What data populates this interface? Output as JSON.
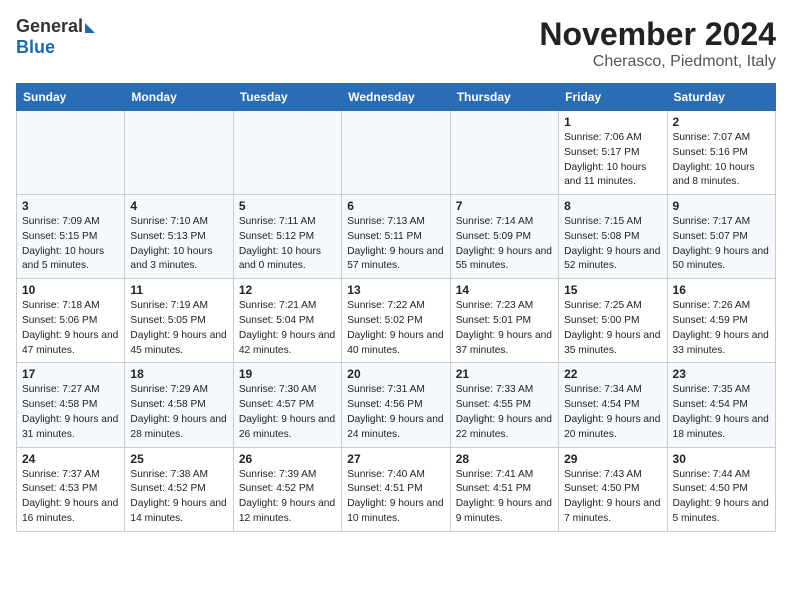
{
  "logo": {
    "general": "General",
    "blue": "Blue"
  },
  "title": "November 2024",
  "subtitle": "Cherasco, Piedmont, Italy",
  "header_days": [
    "Sunday",
    "Monday",
    "Tuesday",
    "Wednesday",
    "Thursday",
    "Friday",
    "Saturday"
  ],
  "weeks": [
    [
      {
        "day": "",
        "info": ""
      },
      {
        "day": "",
        "info": ""
      },
      {
        "day": "",
        "info": ""
      },
      {
        "day": "",
        "info": ""
      },
      {
        "day": "",
        "info": ""
      },
      {
        "day": "1",
        "info": "Sunrise: 7:06 AM\nSunset: 5:17 PM\nDaylight: 10 hours and 11 minutes."
      },
      {
        "day": "2",
        "info": "Sunrise: 7:07 AM\nSunset: 5:16 PM\nDaylight: 10 hours and 8 minutes."
      }
    ],
    [
      {
        "day": "3",
        "info": "Sunrise: 7:09 AM\nSunset: 5:15 PM\nDaylight: 10 hours and 5 minutes."
      },
      {
        "day": "4",
        "info": "Sunrise: 7:10 AM\nSunset: 5:13 PM\nDaylight: 10 hours and 3 minutes."
      },
      {
        "day": "5",
        "info": "Sunrise: 7:11 AM\nSunset: 5:12 PM\nDaylight: 10 hours and 0 minutes."
      },
      {
        "day": "6",
        "info": "Sunrise: 7:13 AM\nSunset: 5:11 PM\nDaylight: 9 hours and 57 minutes."
      },
      {
        "day": "7",
        "info": "Sunrise: 7:14 AM\nSunset: 5:09 PM\nDaylight: 9 hours and 55 minutes."
      },
      {
        "day": "8",
        "info": "Sunrise: 7:15 AM\nSunset: 5:08 PM\nDaylight: 9 hours and 52 minutes."
      },
      {
        "day": "9",
        "info": "Sunrise: 7:17 AM\nSunset: 5:07 PM\nDaylight: 9 hours and 50 minutes."
      }
    ],
    [
      {
        "day": "10",
        "info": "Sunrise: 7:18 AM\nSunset: 5:06 PM\nDaylight: 9 hours and 47 minutes."
      },
      {
        "day": "11",
        "info": "Sunrise: 7:19 AM\nSunset: 5:05 PM\nDaylight: 9 hours and 45 minutes."
      },
      {
        "day": "12",
        "info": "Sunrise: 7:21 AM\nSunset: 5:04 PM\nDaylight: 9 hours and 42 minutes."
      },
      {
        "day": "13",
        "info": "Sunrise: 7:22 AM\nSunset: 5:02 PM\nDaylight: 9 hours and 40 minutes."
      },
      {
        "day": "14",
        "info": "Sunrise: 7:23 AM\nSunset: 5:01 PM\nDaylight: 9 hours and 37 minutes."
      },
      {
        "day": "15",
        "info": "Sunrise: 7:25 AM\nSunset: 5:00 PM\nDaylight: 9 hours and 35 minutes."
      },
      {
        "day": "16",
        "info": "Sunrise: 7:26 AM\nSunset: 4:59 PM\nDaylight: 9 hours and 33 minutes."
      }
    ],
    [
      {
        "day": "17",
        "info": "Sunrise: 7:27 AM\nSunset: 4:58 PM\nDaylight: 9 hours and 31 minutes."
      },
      {
        "day": "18",
        "info": "Sunrise: 7:29 AM\nSunset: 4:58 PM\nDaylight: 9 hours and 28 minutes."
      },
      {
        "day": "19",
        "info": "Sunrise: 7:30 AM\nSunset: 4:57 PM\nDaylight: 9 hours and 26 minutes."
      },
      {
        "day": "20",
        "info": "Sunrise: 7:31 AM\nSunset: 4:56 PM\nDaylight: 9 hours and 24 minutes."
      },
      {
        "day": "21",
        "info": "Sunrise: 7:33 AM\nSunset: 4:55 PM\nDaylight: 9 hours and 22 minutes."
      },
      {
        "day": "22",
        "info": "Sunrise: 7:34 AM\nSunset: 4:54 PM\nDaylight: 9 hours and 20 minutes."
      },
      {
        "day": "23",
        "info": "Sunrise: 7:35 AM\nSunset: 4:54 PM\nDaylight: 9 hours and 18 minutes."
      }
    ],
    [
      {
        "day": "24",
        "info": "Sunrise: 7:37 AM\nSunset: 4:53 PM\nDaylight: 9 hours and 16 minutes."
      },
      {
        "day": "25",
        "info": "Sunrise: 7:38 AM\nSunset: 4:52 PM\nDaylight: 9 hours and 14 minutes."
      },
      {
        "day": "26",
        "info": "Sunrise: 7:39 AM\nSunset: 4:52 PM\nDaylight: 9 hours and 12 minutes."
      },
      {
        "day": "27",
        "info": "Sunrise: 7:40 AM\nSunset: 4:51 PM\nDaylight: 9 hours and 10 minutes."
      },
      {
        "day": "28",
        "info": "Sunrise: 7:41 AM\nSunset: 4:51 PM\nDaylight: 9 hours and 9 minutes."
      },
      {
        "day": "29",
        "info": "Sunrise: 7:43 AM\nSunset: 4:50 PM\nDaylight: 9 hours and 7 minutes."
      },
      {
        "day": "30",
        "info": "Sunrise: 7:44 AM\nSunset: 4:50 PM\nDaylight: 9 hours and 5 minutes."
      }
    ]
  ]
}
